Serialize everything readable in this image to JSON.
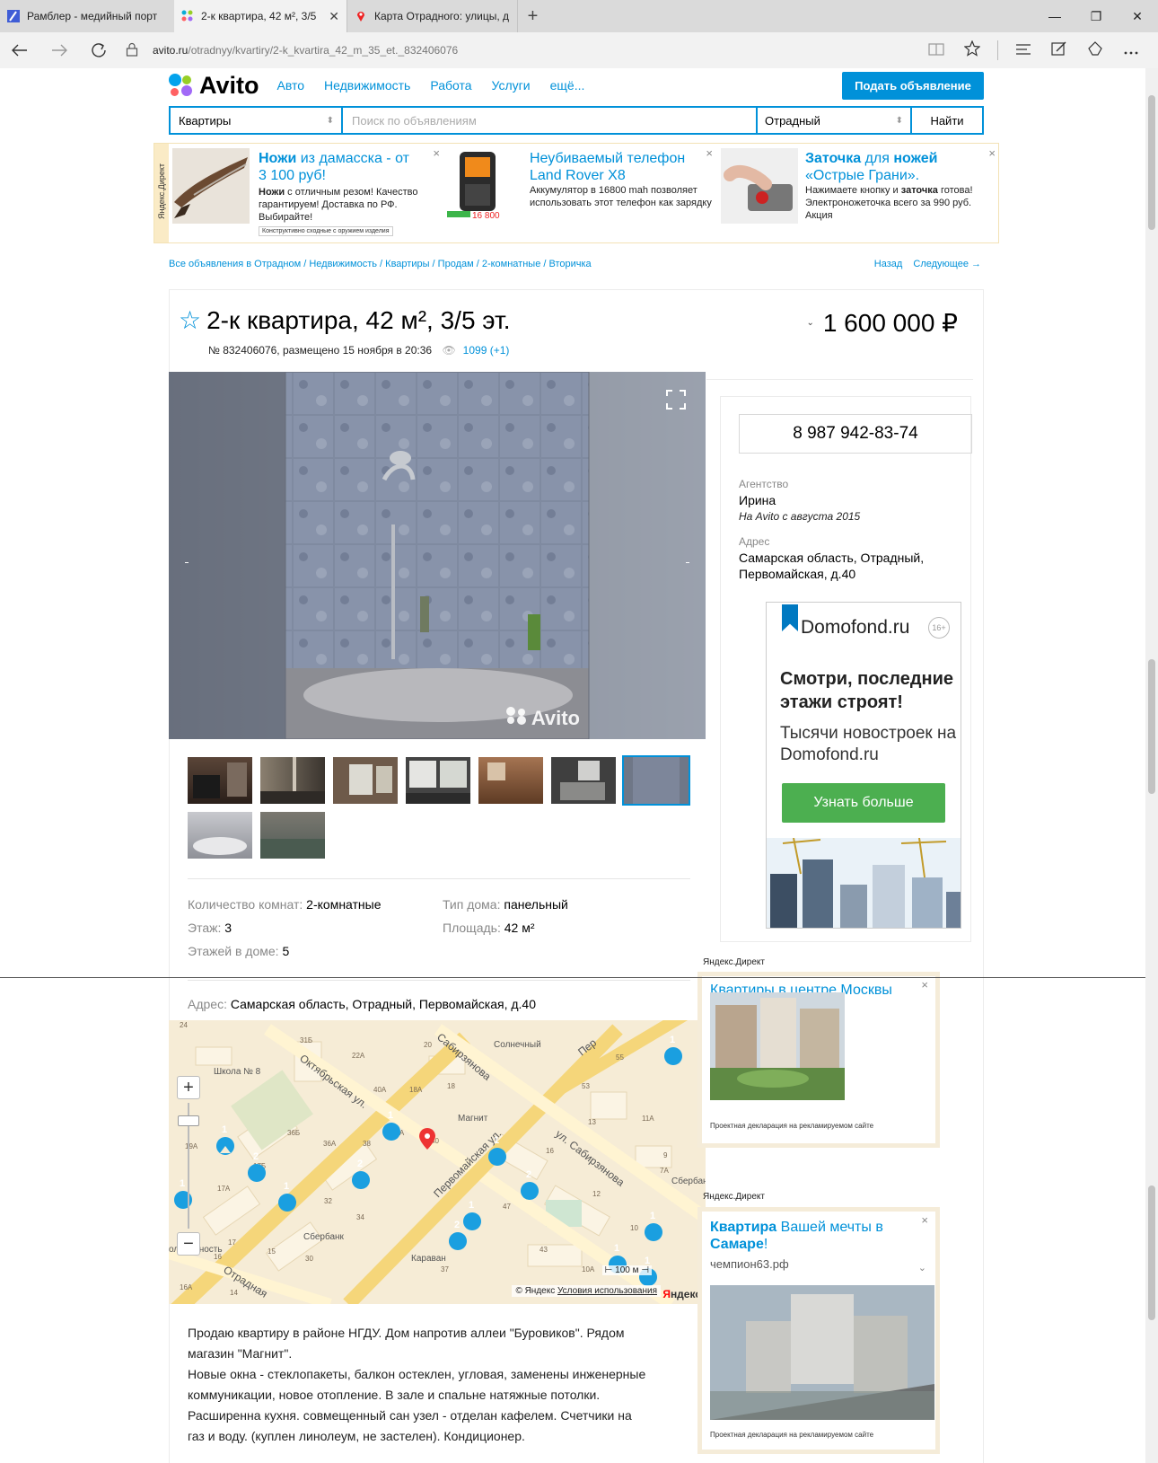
{
  "browser": {
    "tabs": [
      {
        "label": "Рамблер - медийный порт"
      },
      {
        "label": "2-к квартира, 42 м², 3/5"
      },
      {
        "label": "Карта Отрадного: улицы, д"
      }
    ],
    "close_glyph": "✕",
    "new_tab_glyph": "+",
    "window": {
      "minimize": "—",
      "restore": "❐",
      "close": "✕"
    },
    "url_domain": "avito.ru",
    "url_path": "/otradnyy/kvartiry/2-k_kvartira_42_m_35_et._832406076"
  },
  "header": {
    "logo": "Avito",
    "nav": [
      "Авто",
      "Недвижимость",
      "Работа",
      "Услуги",
      "ещё..."
    ],
    "post_button": "Подать объявление"
  },
  "search": {
    "category": "Квартиры",
    "placeholder": "Поиск по объявлениям",
    "city": "Отрадный",
    "submit": "Найти"
  },
  "direct_top": {
    "label": "Яндекс.Директ",
    "ads": [
      {
        "title_bold": "Ножи",
        "title_rest": " из дамасска - от 3 100 руб!",
        "text_bold": "Ножи",
        "text_rest": " с отличным резом! Качество гарантируем! Доставка по РФ. Выбирайте!",
        "small": "Конструктивно сходные с оружием изделия"
      },
      {
        "title": "Неубиваемый телефон Land Rover X8",
        "text": "Аккумулятор в 16800 mah позволяет использовать этот телефон как зарядку",
        "price_badge": "16 800"
      },
      {
        "title_bold": "Заточка",
        "title_mid": " для ",
        "title_bold2": "ножей",
        "title_rest": " «Острые Грани».",
        "text_pre": "Нажимаете кнопку и ",
        "text_bold": "заточка",
        "text_rest": " готова! Электроножеточка всего за 990 руб. Акция"
      }
    ]
  },
  "breadcrumbs": "Все объявления в Отрадном / Недвижимость / Квартиры / Продам / 2-комнатные / Вторичка",
  "prev": "Назад",
  "next": "Следующее →",
  "listing": {
    "title": "2-к квартира, 42 м², 3/5 эт.",
    "price": "1 600 000 ₽",
    "meta": "№ 832406076, размещено 15 ноября в 20:36",
    "views": "1099 (+1)",
    "watermark": "Avito",
    "thumb_count": 9,
    "selected_thumb": 6,
    "params": [
      {
        "k": "Количество комнат: ",
        "v": "2-комнатные"
      },
      {
        "k": "Этаж: ",
        "v": "3"
      },
      {
        "k": "Этажей в доме: ",
        "v": "5"
      },
      {
        "k": "Тип дома: ",
        "v": "панельный"
      },
      {
        "k": "Площадь: ",
        "v": "42 м²"
      }
    ],
    "address_label": "Адрес: ",
    "address": "Самарская область, Отрадный, Первомайская, д.40",
    "description_lines": [
      "Продаю квартиру в районе НГДУ. Дом напротив аллеи \"Буровиков\". Рядом",
      "магазин \"Магнит\".",
      "Новые окна - стеклопакеты, балкон остеклен, угловая, заменены инженерные",
      "коммуникации, новое отопление. В зале и спальне натяжные потолки.",
      "Расширенна кухня. совмещенный сан узел - отделан кафелем. Счетчики на",
      "газ и воду. (куплен линолеум, не застелен). Кондиционер."
    ]
  },
  "map": {
    "streets": [
      "Октябрьская ул.",
      "Первомайская ул.",
      "ул. Сабирзянова",
      "Отрадная",
      "Сабирзянова",
      "Пер"
    ],
    "pois": [
      "Школа № 8",
      "Солнечный",
      "Магнит",
      "Сбербанк",
      "Караван",
      "Сбербанк",
      "олидарность"
    ],
    "houses": [
      "24",
      "31Б",
      "22А",
      "20",
      "55",
      "40А",
      "18А",
      "18",
      "53",
      "36Б",
      "36А",
      "38",
      "34А",
      "40",
      "13",
      "11А",
      "19А",
      "17Б",
      "16",
      "9",
      "7А",
      "17А",
      "14А",
      "32",
      "34",
      "12",
      "47",
      "10",
      "17",
      "16",
      "15",
      "30",
      "37",
      "43",
      "10А",
      "16А",
      "14"
    ],
    "scale": "100 м",
    "copyright": "© Яндекс",
    "terms": "Условия использования",
    "logo_first": "Я",
    "logo_rest": "ндекс",
    "zoom_in": "+",
    "zoom_out": "−"
  },
  "seller": {
    "phone": "8 987 942-83-74",
    "type_label": "Агентство",
    "name": "Ирина",
    "since": "На Avito с августа 2015",
    "address_label": "Адрес",
    "address": "Самарская область, Отрадный, Первомайская, д.40"
  },
  "domofond": {
    "brand": "Domofond.ru",
    "age": "16+",
    "headline": "Смотри, последние этажи строят!",
    "sub": "Тысячи новостроек на Domofond.ru",
    "cta": "Узнать больше"
  },
  "side_ads": {
    "label": "Яндекс.Директ",
    "ad1": {
      "title": "Квартиры в центре Москвы",
      "caption": "Проектная декларация на рекламируемом сайте"
    },
    "ad2": {
      "title_bold": "Квартира",
      "title_rest": " Вашей мечты в ",
      "title_bold2": "Самаре",
      "title_end": "!",
      "domain": "чемпион63.рф",
      "caption": "Проектная декларация на рекламируемом сайте"
    }
  },
  "colors": {
    "accent": "#0091d9",
    "green": "#4caf50",
    "map_bg": "#f6ecd6",
    "map_road": "#f5d67a",
    "pin": "#1a9fe0",
    "marker": "#e33"
  }
}
